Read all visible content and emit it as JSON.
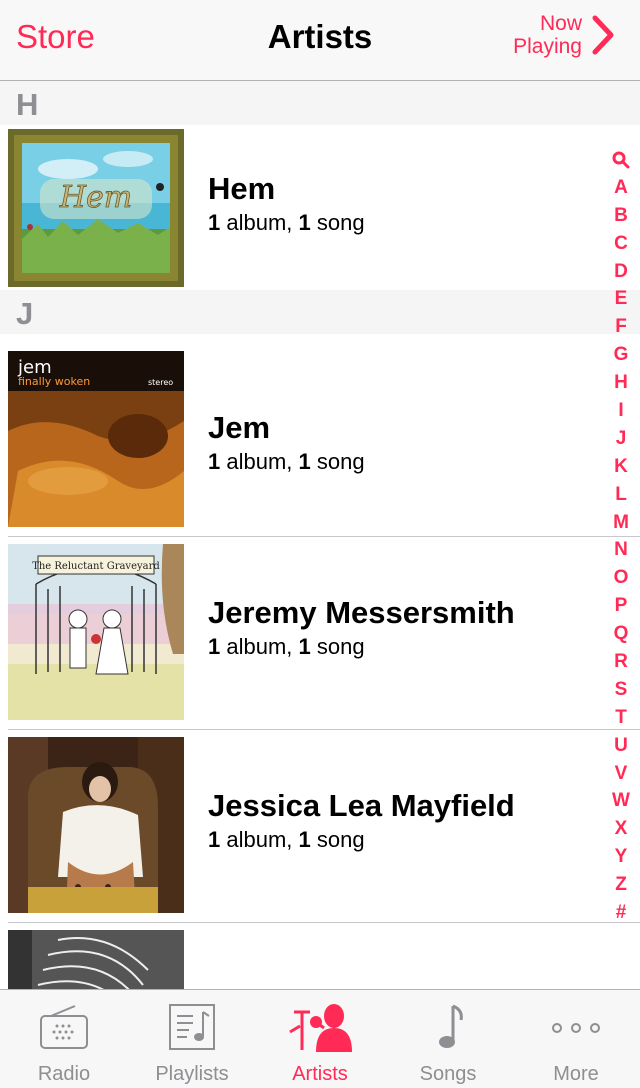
{
  "navbar": {
    "left_label": "Store",
    "title": "Artists",
    "right_line1": "Now",
    "right_line2": "Playing"
  },
  "sections": [
    {
      "letter": "H",
      "artists": [
        {
          "name": "Hem",
          "albums": "1",
          "album_word": " album, ",
          "songs": "1",
          "song_word": " song",
          "art": "hem-art"
        }
      ]
    },
    {
      "letter": "J",
      "artists": [
        {
          "name": "Jem",
          "albums": "1",
          "album_word": " album, ",
          "songs": "1",
          "song_word": " song",
          "art": "jem-art",
          "art_text1": "jem",
          "art_text2": "finally woken",
          "art_text3": "stereo"
        },
        {
          "name": "Jeremy Messersmith",
          "albums": "1",
          "album_word": " album, ",
          "songs": "1",
          "song_word": " song",
          "art": "jeremy-art",
          "art_text1": "The Reluctant Graveyard"
        },
        {
          "name": "Jessica Lea Mayfield",
          "albums": "1",
          "album_word": " album, ",
          "songs": "1",
          "song_word": " song",
          "art": "jessica-art"
        }
      ]
    }
  ],
  "hem_art_text": "Hem",
  "index": [
    "search",
    "A",
    "B",
    "C",
    "D",
    "E",
    "F",
    "G",
    "H",
    "I",
    "J",
    "K",
    "L",
    "M",
    "N",
    "O",
    "P",
    "Q",
    "R",
    "S",
    "T",
    "U",
    "V",
    "W",
    "X",
    "Y",
    "Z",
    "#"
  ],
  "tabs": [
    {
      "label": "Radio",
      "icon": "radio-icon",
      "active": false
    },
    {
      "label": "Playlists",
      "icon": "playlists-icon",
      "active": false
    },
    {
      "label": "Artists",
      "icon": "artists-icon",
      "active": true
    },
    {
      "label": "Songs",
      "icon": "songs-icon",
      "active": false
    },
    {
      "label": "More",
      "icon": "more-icon",
      "active": false
    }
  ],
  "colors": {
    "accent": "#ff2a55",
    "inactive": "#8e8e93",
    "header_bg": "#f5f5f5"
  }
}
